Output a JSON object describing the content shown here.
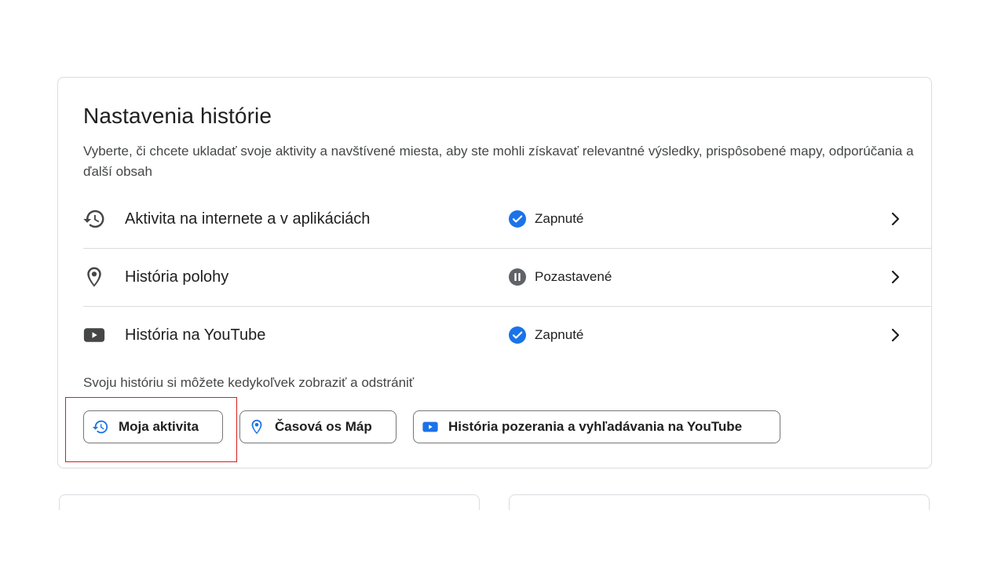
{
  "section": {
    "title": "Nastavenia histórie",
    "description": "Vyberte, či chcete ukladať svoje aktivity a navštívené miesta, aby ste mohli získavať relevantné výsledky, prispôsobené mapy, odporúčania a ďalší obsah"
  },
  "rows": [
    {
      "label": "Aktivita na internete a v aplikáciách",
      "icon": "history-icon",
      "status": "Zapnuté",
      "status_icon": "check-circle-icon"
    },
    {
      "label": "História polohy",
      "icon": "location-pin-icon",
      "status": "Pozastavené",
      "status_icon": "pause-circle-icon"
    },
    {
      "label": "História na YouTube",
      "icon": "youtube-icon",
      "status": "Zapnuté",
      "status_icon": "check-circle-icon"
    }
  ],
  "note": "Svoju históriu si môžete kedykoľvek zobraziť a odstrániť",
  "buttons": [
    {
      "label": "Moja aktivita",
      "icon": "history-icon"
    },
    {
      "label": "Časová os Máp",
      "icon": "location-pin-icon"
    },
    {
      "label": "História pozerania a vyhľadávania na YouTube",
      "icon": "youtube-icon"
    }
  ],
  "colors": {
    "accent_blue": "#1a73e8",
    "icon_gray": "#444746",
    "divider": "#dadce0",
    "highlight_red": "#d61f1f"
  }
}
